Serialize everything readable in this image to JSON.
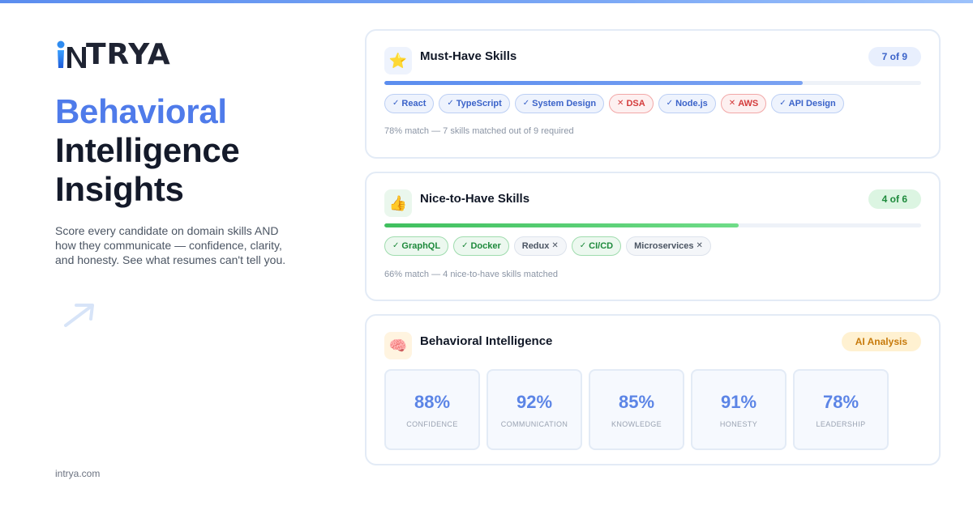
{
  "brand": {
    "logo_text": "TRYA",
    "logo_full": "iNTRYA",
    "accent_color": "#4f7bea"
  },
  "hero": {
    "headline_accent": "Behavioral",
    "headline_line2": "Intelligence",
    "headline_line3": "Insights",
    "tagline": "Score every candidate on domain skills AND how they communicate — confidence, clarity, and honesty. See what resumes can't tell you.",
    "site": "intrya.com"
  },
  "must_have": {
    "icon": "star-icon",
    "title": "Must-Have Skills",
    "badge": "7 of 9",
    "progress": 0.78,
    "color": "#5b8def",
    "skills": [
      {
        "label": "React",
        "matched": true
      },
      {
        "label": "TypeScript",
        "matched": true
      },
      {
        "label": "System Design",
        "matched": true
      },
      {
        "label": "DSA",
        "matched": false
      },
      {
        "label": "Node.js",
        "matched": true
      },
      {
        "label": "AWS",
        "matched": false
      },
      {
        "label": "API Design",
        "matched": true
      }
    ],
    "summary": "78% match — 7 skills matched out of 9 required"
  },
  "nice_to_have": {
    "icon": "thumbs-up-icon",
    "title": "Nice-to-Have Skills",
    "badge": "4 of 6",
    "progress": 0.66,
    "color": "#4cc96a",
    "skills": [
      {
        "label": "GraphQL",
        "matched": true
      },
      {
        "label": "Docker",
        "matched": true
      },
      {
        "label": "Redux",
        "matched": false
      },
      {
        "label": "CI/CD",
        "matched": true
      },
      {
        "label": "Microservices",
        "matched": false
      }
    ],
    "summary": "66% match — 4 nice-to-have skills matched"
  },
  "behavioral": {
    "icon": "brain-icon",
    "title": "Behavioral Intelligence",
    "badge": "AI Analysis",
    "metrics": [
      {
        "value": "88%",
        "label": "CONFIDENCE"
      },
      {
        "value": "92%",
        "label": "COMMUNICATION"
      },
      {
        "value": "85%",
        "label": "KNOWLEDGE"
      },
      {
        "value": "91%",
        "label": "HONESTY"
      },
      {
        "value": "78%",
        "label": "LEADERSHIP"
      }
    ]
  }
}
